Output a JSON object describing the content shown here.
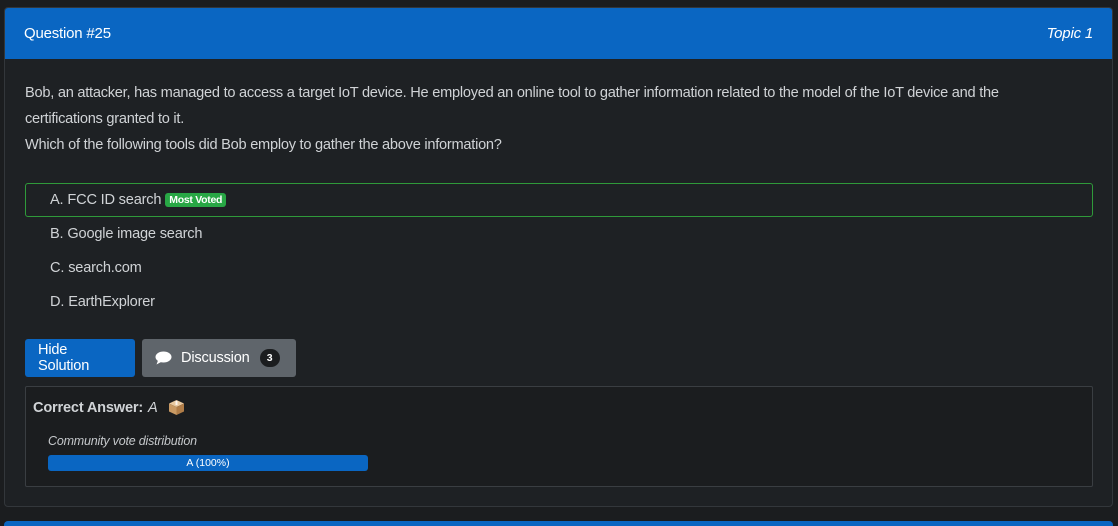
{
  "header": {
    "question_number": "Question #25",
    "topic": "Topic 1"
  },
  "question": {
    "paragraph1": "Bob, an attacker, has managed to access a target IoT device. He employed an online tool to gather information related to the model of the IoT device and the certifications granted to it.",
    "paragraph2": "Which of the following tools did Bob employ to gather the above information?"
  },
  "choices": [
    {
      "letter": "A.",
      "text": "FCC ID search",
      "badge": "Most Voted"
    },
    {
      "letter": "B.",
      "text": "Google image search"
    },
    {
      "letter": "C.",
      "text": "search.com"
    },
    {
      "letter": "D.",
      "text": "EarthExplorer"
    }
  ],
  "buttons": {
    "hide_solution": "Hide Solution",
    "discussion": "Discussion",
    "discussion_count": "3"
  },
  "answer": {
    "label": "Correct Answer:",
    "value": "A",
    "vote_title": "Community vote distribution",
    "vote_bar_label": "A (100%)",
    "vote_fraction": 1.0
  },
  "colors": {
    "accent": "#0a66c2",
    "correct_border": "#2f9a3a",
    "badge": "#28a745"
  },
  "icons": {
    "discussion": "chat-bubble-icon",
    "answer": "ballot-box-icon"
  }
}
